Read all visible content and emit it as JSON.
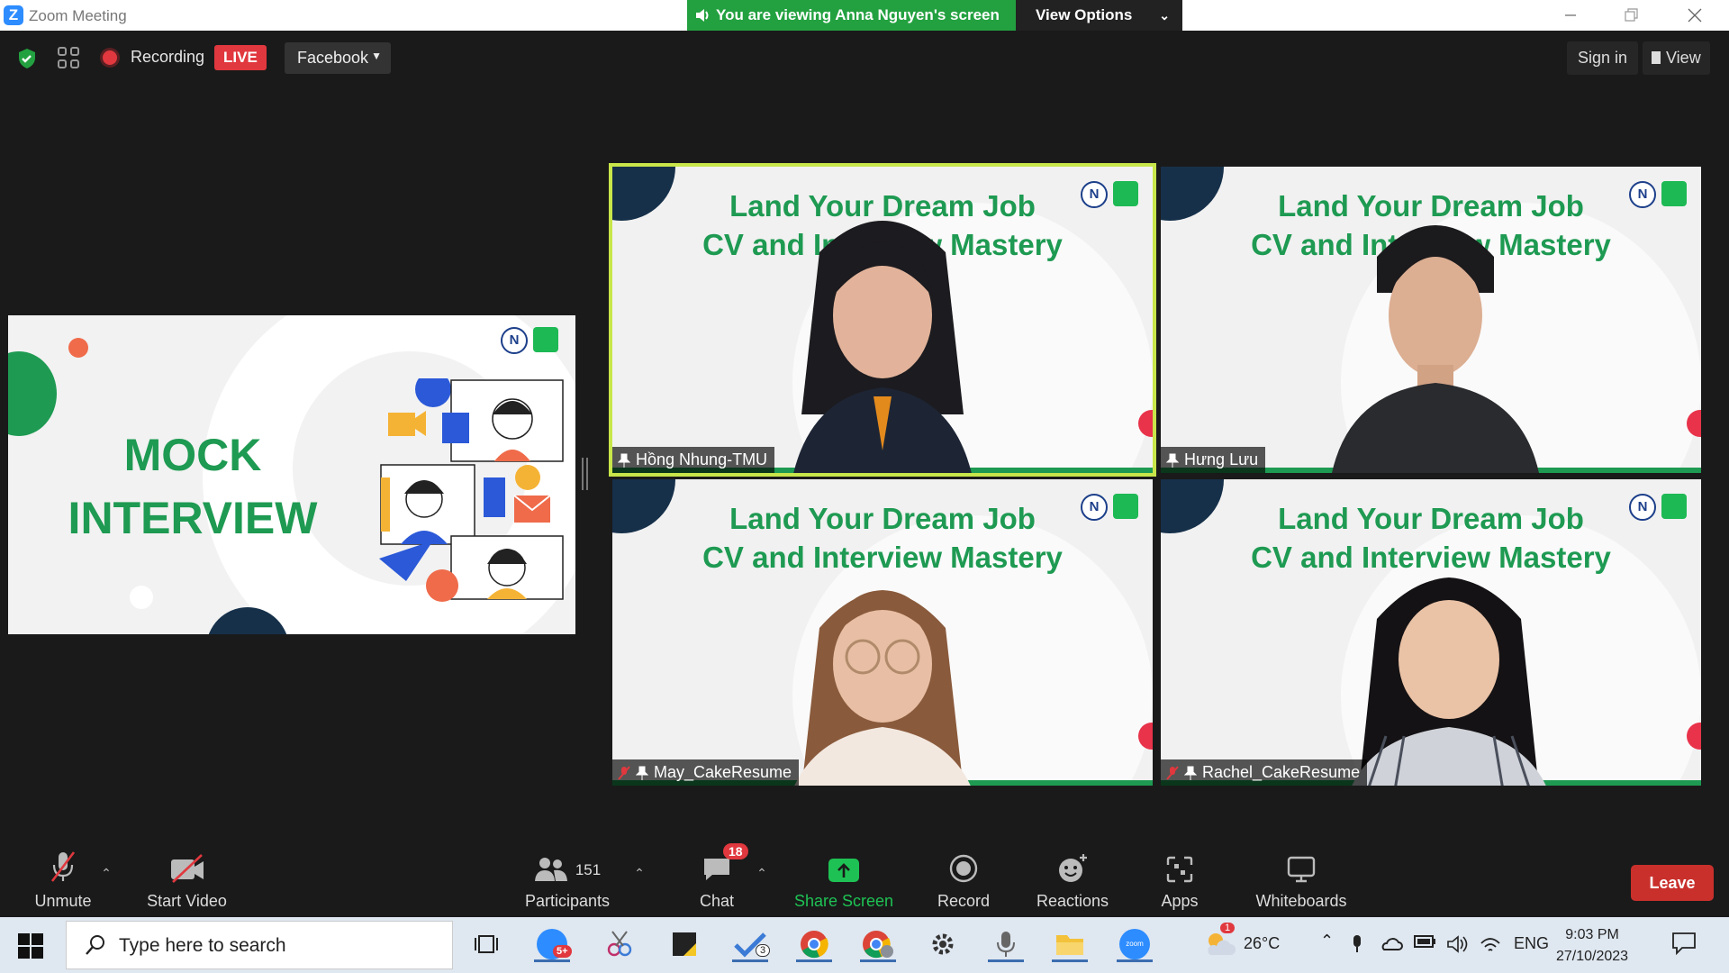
{
  "window": {
    "title": "Zoom Meeting",
    "banner_text": "You are viewing Anna Nguyen's screen",
    "view_options_label": "View Options"
  },
  "topbar": {
    "recording_label": "Recording",
    "live_label": "LIVE",
    "stream_target": "Facebook",
    "signin_label": "Sign in",
    "view_label": "View"
  },
  "shared_slide": {
    "line1": "MOCK",
    "line2": "INTERVIEW"
  },
  "slide": {
    "title_line1": "Land Your Dream Job",
    "title_line2": "CV and Interview Mastery",
    "logo_letter": "N"
  },
  "participants": [
    {
      "name": "Hồng Nhung-TMU",
      "active_speaker": true,
      "muted": false
    },
    {
      "name": "Hưng Lưu",
      "active_speaker": false,
      "muted": false
    },
    {
      "name": "May_CakeResume",
      "active_speaker": false,
      "muted": true
    },
    {
      "name": "Rachel_CakeResume",
      "active_speaker": false,
      "muted": true
    }
  ],
  "toolbar": {
    "unmute": "Unmute",
    "start_video": "Start Video",
    "participants": "Participants",
    "participant_count": "151",
    "chat": "Chat",
    "chat_badge": "18",
    "share_screen": "Share Screen",
    "record": "Record",
    "reactions": "Reactions",
    "apps": "Apps",
    "whiteboards": "Whiteboards",
    "leave": "Leave"
  },
  "taskbar": {
    "search_placeholder": "Type here to search",
    "zoom_badge": "5+",
    "task_badge": "3",
    "weather_badge": "1",
    "temperature": "26°C",
    "language": "ENG",
    "time": "9:03 PM",
    "date": "27/10/2023"
  },
  "colors": {
    "accent_green": "#1e9a52",
    "speaker_border": "#c8e64a",
    "leave_red": "#c9302c",
    "live_red": "#e0383e",
    "zoom_blue": "#2d8cff"
  }
}
